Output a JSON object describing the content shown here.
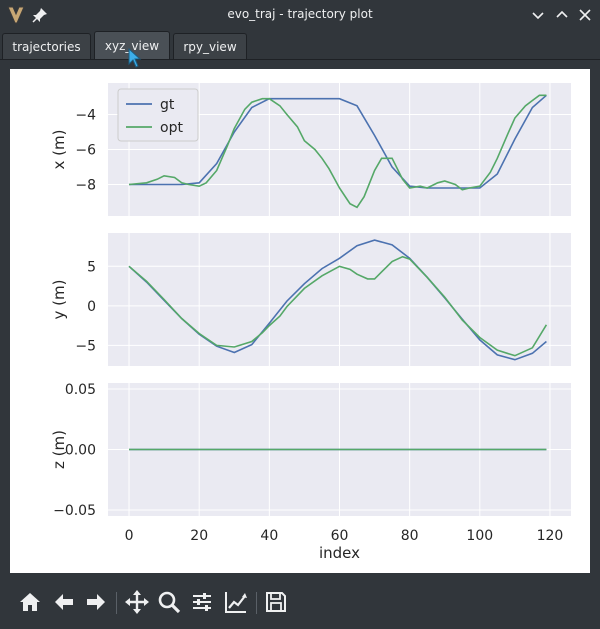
{
  "window": {
    "title": "evo_traj - trajectory plot",
    "icons": [
      "app-logo-icon",
      "pin-icon",
      "minimize-icon",
      "maximize-icon",
      "close-icon"
    ]
  },
  "tabs": [
    {
      "label": "trajectories",
      "active": false
    },
    {
      "label": "xyz_view",
      "active": true
    },
    {
      "label": "rpy_view",
      "active": false
    }
  ],
  "toolbar": {
    "tools": [
      "home-icon",
      "back-icon",
      "forward-icon",
      "pan-icon",
      "zoom-icon",
      "configure-subplots-icon",
      "edit-curves-icon",
      "save-icon"
    ]
  },
  "colors": {
    "gt": "#4c72b0",
    "opt": "#55a868",
    "axes_bg": "#eaeaf2",
    "grid": "#ffffff"
  },
  "chart_data": [
    {
      "type": "line",
      "ylabel": "x (m)",
      "xlabel": "",
      "xlim": [
        -6,
        126
      ],
      "ylim": [
        -9.8,
        -2.2
      ],
      "yticks": [
        -8,
        -6,
        -4
      ],
      "ytick_labels": [
        "−8",
        "−6",
        "−4"
      ],
      "grid": true,
      "legend": "top-left",
      "series": [
        {
          "name": "gt",
          "x": [
            0,
            5,
            10,
            15,
            20,
            25,
            30,
            35,
            40,
            45,
            50,
            55,
            60,
            65,
            70,
            75,
            80,
            85,
            90,
            95,
            100,
            105,
            110,
            115,
            119
          ],
          "y": [
            -8.0,
            -8.0,
            -8.0,
            -8.0,
            -7.9,
            -6.8,
            -5.0,
            -3.6,
            -3.1,
            -3.1,
            -3.1,
            -3.1,
            -3.1,
            -3.5,
            -5.2,
            -7.0,
            -8.1,
            -8.2,
            -8.2,
            -8.2,
            -8.2,
            -7.4,
            -5.4,
            -3.6,
            -2.9
          ]
        },
        {
          "name": "opt",
          "x": [
            0,
            5,
            8,
            10,
            13,
            15,
            17,
            20,
            22,
            25,
            28,
            30,
            33,
            35,
            38,
            40,
            43,
            45,
            48,
            50,
            53,
            55,
            57,
            60,
            62,
            63,
            65,
            67,
            70,
            72,
            75,
            78,
            80,
            83,
            85,
            88,
            90,
            93,
            95,
            97,
            100,
            103,
            105,
            108,
            110,
            113,
            115,
            117,
            119
          ],
          "y": [
            -8.0,
            -7.9,
            -7.7,
            -7.5,
            -7.6,
            -7.9,
            -8.0,
            -8.1,
            -7.9,
            -7.2,
            -5.8,
            -4.8,
            -3.7,
            -3.3,
            -3.1,
            -3.1,
            -3.5,
            -4.0,
            -4.7,
            -5.5,
            -6.0,
            -6.5,
            -7.1,
            -8.2,
            -8.8,
            -9.1,
            -9.3,
            -8.7,
            -7.2,
            -6.5,
            -6.5,
            -7.7,
            -8.2,
            -8.1,
            -8.2,
            -7.9,
            -7.8,
            -8.0,
            -8.3,
            -8.2,
            -8.1,
            -7.3,
            -6.5,
            -5.1,
            -4.2,
            -3.5,
            -3.2,
            -2.9,
            -2.9
          ]
        }
      ]
    },
    {
      "type": "line",
      "ylabel": "y (m)",
      "xlabel": "",
      "xlim": [
        -6,
        126
      ],
      "ylim": [
        -7.6,
        9.2
      ],
      "yticks": [
        -5,
        0,
        5
      ],
      "ytick_labels": [
        "−5",
        "0",
        "5"
      ],
      "grid": true,
      "series": [
        {
          "name": "gt",
          "x": [
            0,
            5,
            10,
            15,
            20,
            25,
            30,
            35,
            40,
            45,
            50,
            55,
            60,
            65,
            70,
            75,
            80,
            85,
            90,
            95,
            100,
            105,
            110,
            115,
            119
          ],
          "y": [
            5.0,
            3.0,
            0.7,
            -1.6,
            -3.6,
            -5.1,
            -5.9,
            -4.9,
            -2.2,
            0.6,
            2.8,
            4.7,
            6.0,
            7.6,
            8.3,
            7.7,
            6.0,
            3.6,
            1.0,
            -1.7,
            -4.3,
            -6.2,
            -6.8,
            -6.0,
            -4.5
          ]
        },
        {
          "name": "opt",
          "x": [
            0,
            5,
            10,
            15,
            20,
            25,
            30,
            35,
            38,
            40,
            43,
            45,
            50,
            55,
            60,
            63,
            65,
            68,
            70,
            75,
            78,
            80,
            85,
            90,
            95,
            100,
            105,
            110,
            115,
            119
          ],
          "y": [
            5.0,
            3.1,
            0.8,
            -1.6,
            -3.5,
            -5.0,
            -5.2,
            -4.5,
            -3.4,
            -2.5,
            -1.3,
            -0.1,
            2.2,
            3.8,
            5.0,
            4.6,
            4.0,
            3.4,
            3.4,
            5.6,
            6.2,
            5.9,
            3.6,
            1.1,
            -1.8,
            -4.0,
            -5.6,
            -6.3,
            -5.3,
            -2.4
          ]
        }
      ]
    },
    {
      "type": "line",
      "ylabel": "z (m)",
      "xlabel": "index",
      "xlim": [
        -6,
        126
      ],
      "xticks": [
        0,
        20,
        40,
        60,
        80,
        100,
        120
      ],
      "xtick_labels": [
        "0",
        "20",
        "40",
        "60",
        "80",
        "100",
        "120"
      ],
      "ylim": [
        -0.055,
        0.055
      ],
      "yticks": [
        -0.05,
        0.0,
        0.05
      ],
      "ytick_labels": [
        "−0.05",
        "0.00",
        "0.05"
      ],
      "grid": true,
      "series": [
        {
          "name": "gt",
          "x": [
            0,
            119
          ],
          "y": [
            0.0,
            0.0
          ]
        },
        {
          "name": "opt",
          "x": [
            0,
            119
          ],
          "y": [
            0.0,
            0.0
          ]
        }
      ]
    }
  ]
}
